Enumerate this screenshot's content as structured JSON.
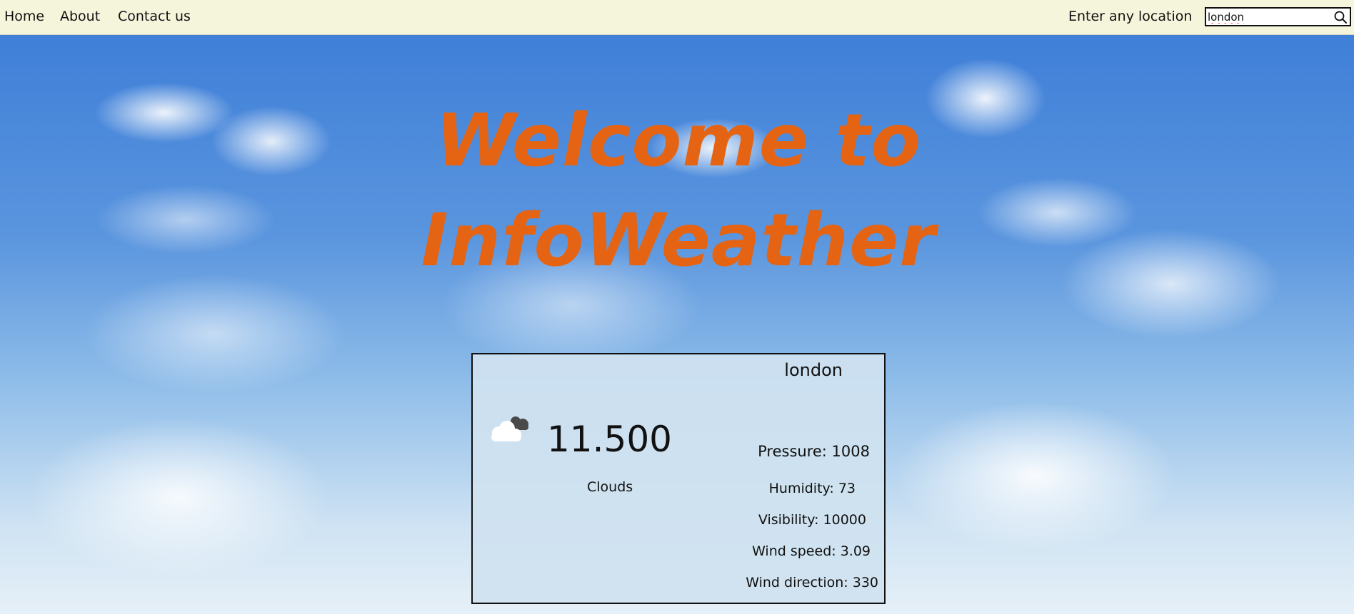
{
  "nav": {
    "home": "Home",
    "about": "About",
    "contact": "Contact us"
  },
  "search": {
    "label": "Enter any location",
    "value": "london",
    "icon": "search-icon"
  },
  "hero": {
    "title_line1": "Welcome to",
    "title_line2": "InfoWeather",
    "title_color": "#e46414"
  },
  "weather": {
    "city": "london",
    "temperature": "11.500",
    "condition": "Clouds",
    "condition_icon": "cloud-icon",
    "pressure": "Pressure: 1008",
    "humidity": "Humidity: 73",
    "visibility": "Visibility: 10000",
    "wind_speed": "Wind speed: 3.09",
    "wind_direction": "Wind direction: 330"
  },
  "colors": {
    "navbar_bg": "#f5f5dc",
    "card_bg": "#d0e2f0"
  }
}
